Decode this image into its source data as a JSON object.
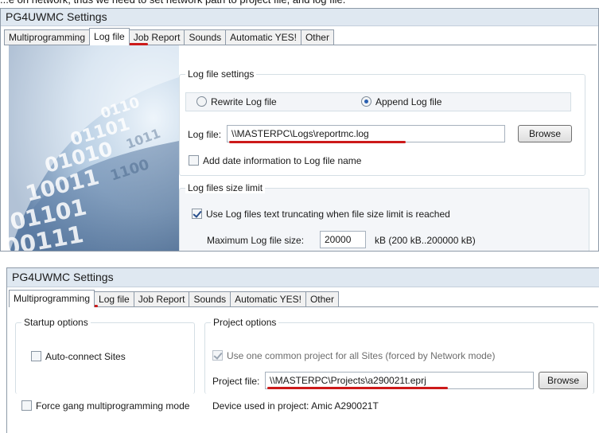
{
  "caption": "...e on network, thus we need to set network path to project file, and log file.",
  "accent_color": "#cc1a1a",
  "window1": {
    "title": "PG4UWMC Settings",
    "tabs": [
      {
        "label": "Multiprogramming",
        "active": false
      },
      {
        "label": "Log file",
        "active": true
      },
      {
        "label": "Job Report",
        "active": false
      },
      {
        "label": "Sounds",
        "active": false
      },
      {
        "label": "Automatic YES!",
        "active": false
      },
      {
        "label": "Other",
        "active": false
      }
    ],
    "log_settings": {
      "legend": "Log file settings",
      "rewrite_label": "Rewrite Log file",
      "rewrite_selected": false,
      "append_label": "Append Log file",
      "append_selected": true,
      "log_file_label": "Log file:",
      "log_file_value": "\\\\MASTERPC\\Logs\\reportmc.log",
      "browse_label": "Browse",
      "add_date_label": "Add date information to Log file name",
      "add_date_checked": false
    },
    "size_limit": {
      "legend": "Log files size limit",
      "truncate_label": "Use Log files text truncating when file size limit is reached",
      "truncate_checked": true,
      "max_size_label": "Maximum Log file size:",
      "max_size_value": "20000",
      "unit_label": "kB  (200 kB..200000 kB)"
    },
    "decor_icon": "binary-digits-image"
  },
  "window2": {
    "title": "PG4UWMC Settings",
    "tabs": [
      {
        "label": "Multiprogramming",
        "active": true
      },
      {
        "label": "Log file",
        "active": false
      },
      {
        "label": "Job Report",
        "active": false
      },
      {
        "label": "Sounds",
        "active": false
      },
      {
        "label": "Automatic YES!",
        "active": false
      },
      {
        "label": "Other",
        "active": false
      }
    ],
    "startup": {
      "legend": "Startup options",
      "auto_connect_label": "Auto-connect Sites",
      "auto_connect_checked": false
    },
    "force_gang_label": "Force gang multiprogramming mode",
    "force_gang_checked": false,
    "project": {
      "legend": "Project options",
      "common_project_label": "Use one common project for all Sites (forced by Network mode)",
      "common_project_checked": true,
      "project_file_label": "Project file:",
      "project_file_value": "\\\\MASTERPC\\Projects\\a290021t.eprj",
      "browse_label": "Browse",
      "device_label": "Device used in project: Amic A290021T"
    }
  }
}
